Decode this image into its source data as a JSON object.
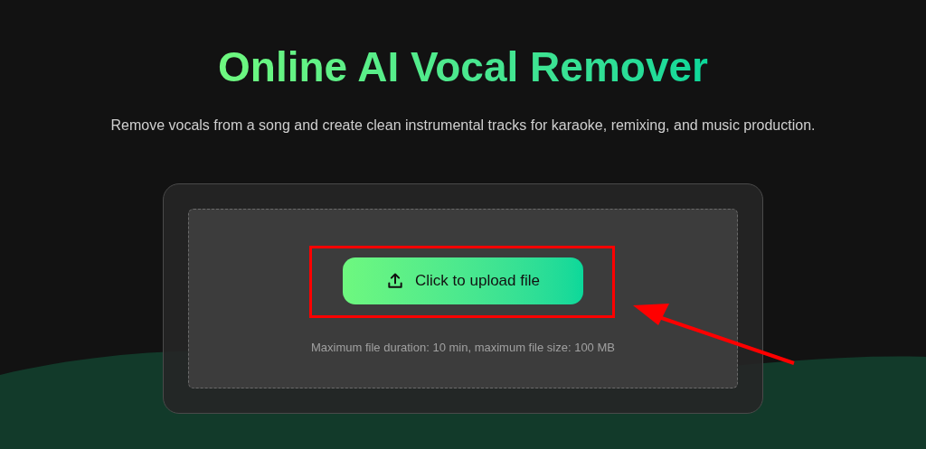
{
  "title": "Online AI Vocal Remover",
  "subtitle": "Remove vocals from a song and create clean instrumental tracks for karaoke, remixing, and music production.",
  "upload": {
    "button": "Click to upload file",
    "note": "Maximum file duration: 10 min, maximum file size: 100 MB"
  }
}
